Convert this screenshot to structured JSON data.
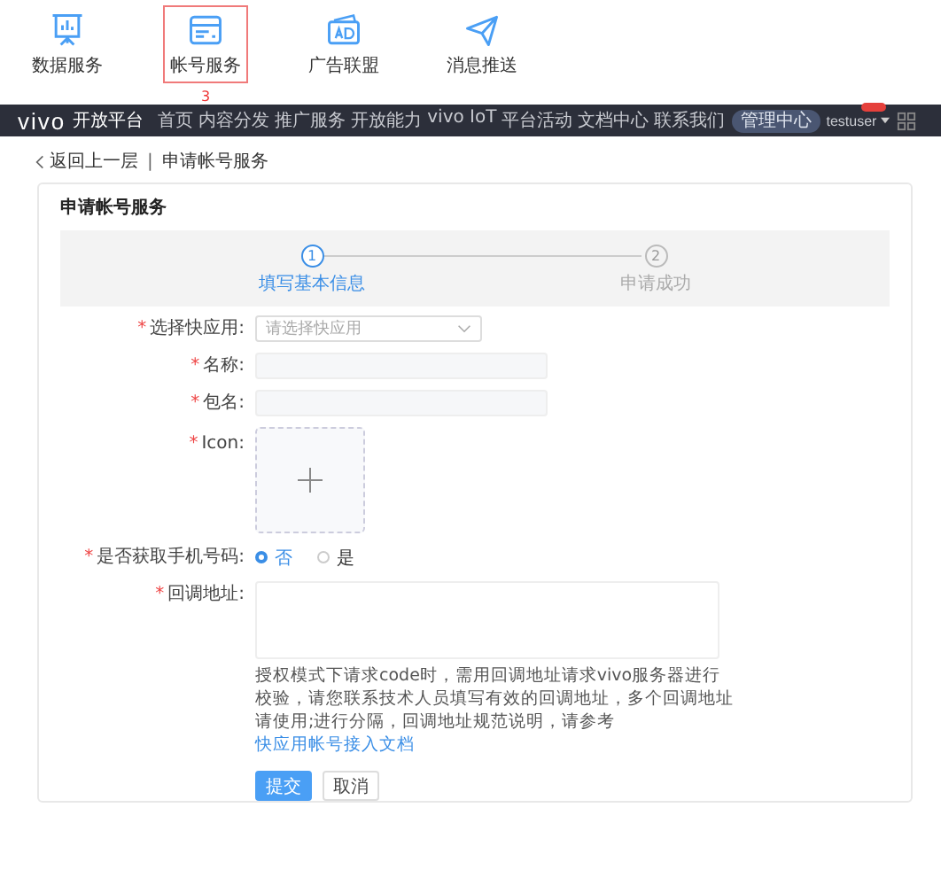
{
  "top_tiles": [
    {
      "kind": "board",
      "label": "数据服务",
      "selected": false
    },
    {
      "kind": "card",
      "label": "帐号服务",
      "selected": true,
      "marker": "3"
    },
    {
      "kind": "ad",
      "label": "广告联盟",
      "selected": false
    },
    {
      "kind": "plane",
      "label": "消息推送",
      "selected": false
    }
  ],
  "navbar": {
    "logo": "vivo",
    "platform": "开放平台",
    "items": [
      "首页",
      "内容分发",
      "推广服务",
      "开放能力",
      "vivo IoT",
      "平台活动",
      "文档中心",
      "联系我们"
    ],
    "admin_button": "管理中心",
    "user": "testuser"
  },
  "breadcrumb": {
    "back": "返回上一层",
    "separator": "|",
    "current": "申请帐号服务"
  },
  "card": {
    "title": "申请帐号服务",
    "steps": [
      {
        "number": "1",
        "label": "填写基本信息",
        "active": true
      },
      {
        "number": "2",
        "label": "申请成功",
        "active": false
      }
    ],
    "fields": [
      {
        "kind": "select",
        "mark": "*",
        "label": "选择快应用:",
        "placeholder": "请选择快应用"
      },
      {
        "kind": "input",
        "mark": "*",
        "label": "名称:"
      },
      {
        "kind": "input",
        "mark": "*",
        "label": "包名:"
      },
      {
        "kind": "upload",
        "mark": "*",
        "label": "Icon:"
      },
      {
        "kind": "radio",
        "mark": "*",
        "label": "是否获取手机号码:",
        "options": [
          {
            "label": "否",
            "selected": true
          },
          {
            "label": "是",
            "selected": false
          }
        ]
      },
      {
        "kind": "textarea",
        "mark": "*",
        "label": "回调地址:",
        "help": "授权模式下请求code时，需用回调地址请求vivo服务器进行校验，请您联系技术人员填写有效的回调地址，多个回调地址请使用;进行分隔，回调地址规范说明，请参考",
        "help_link": "快应用帐号接入文档"
      }
    ],
    "buttons": [
      {
        "kind": "primary",
        "label": "提交"
      },
      {
        "kind": "default",
        "label": "取消"
      }
    ]
  }
}
